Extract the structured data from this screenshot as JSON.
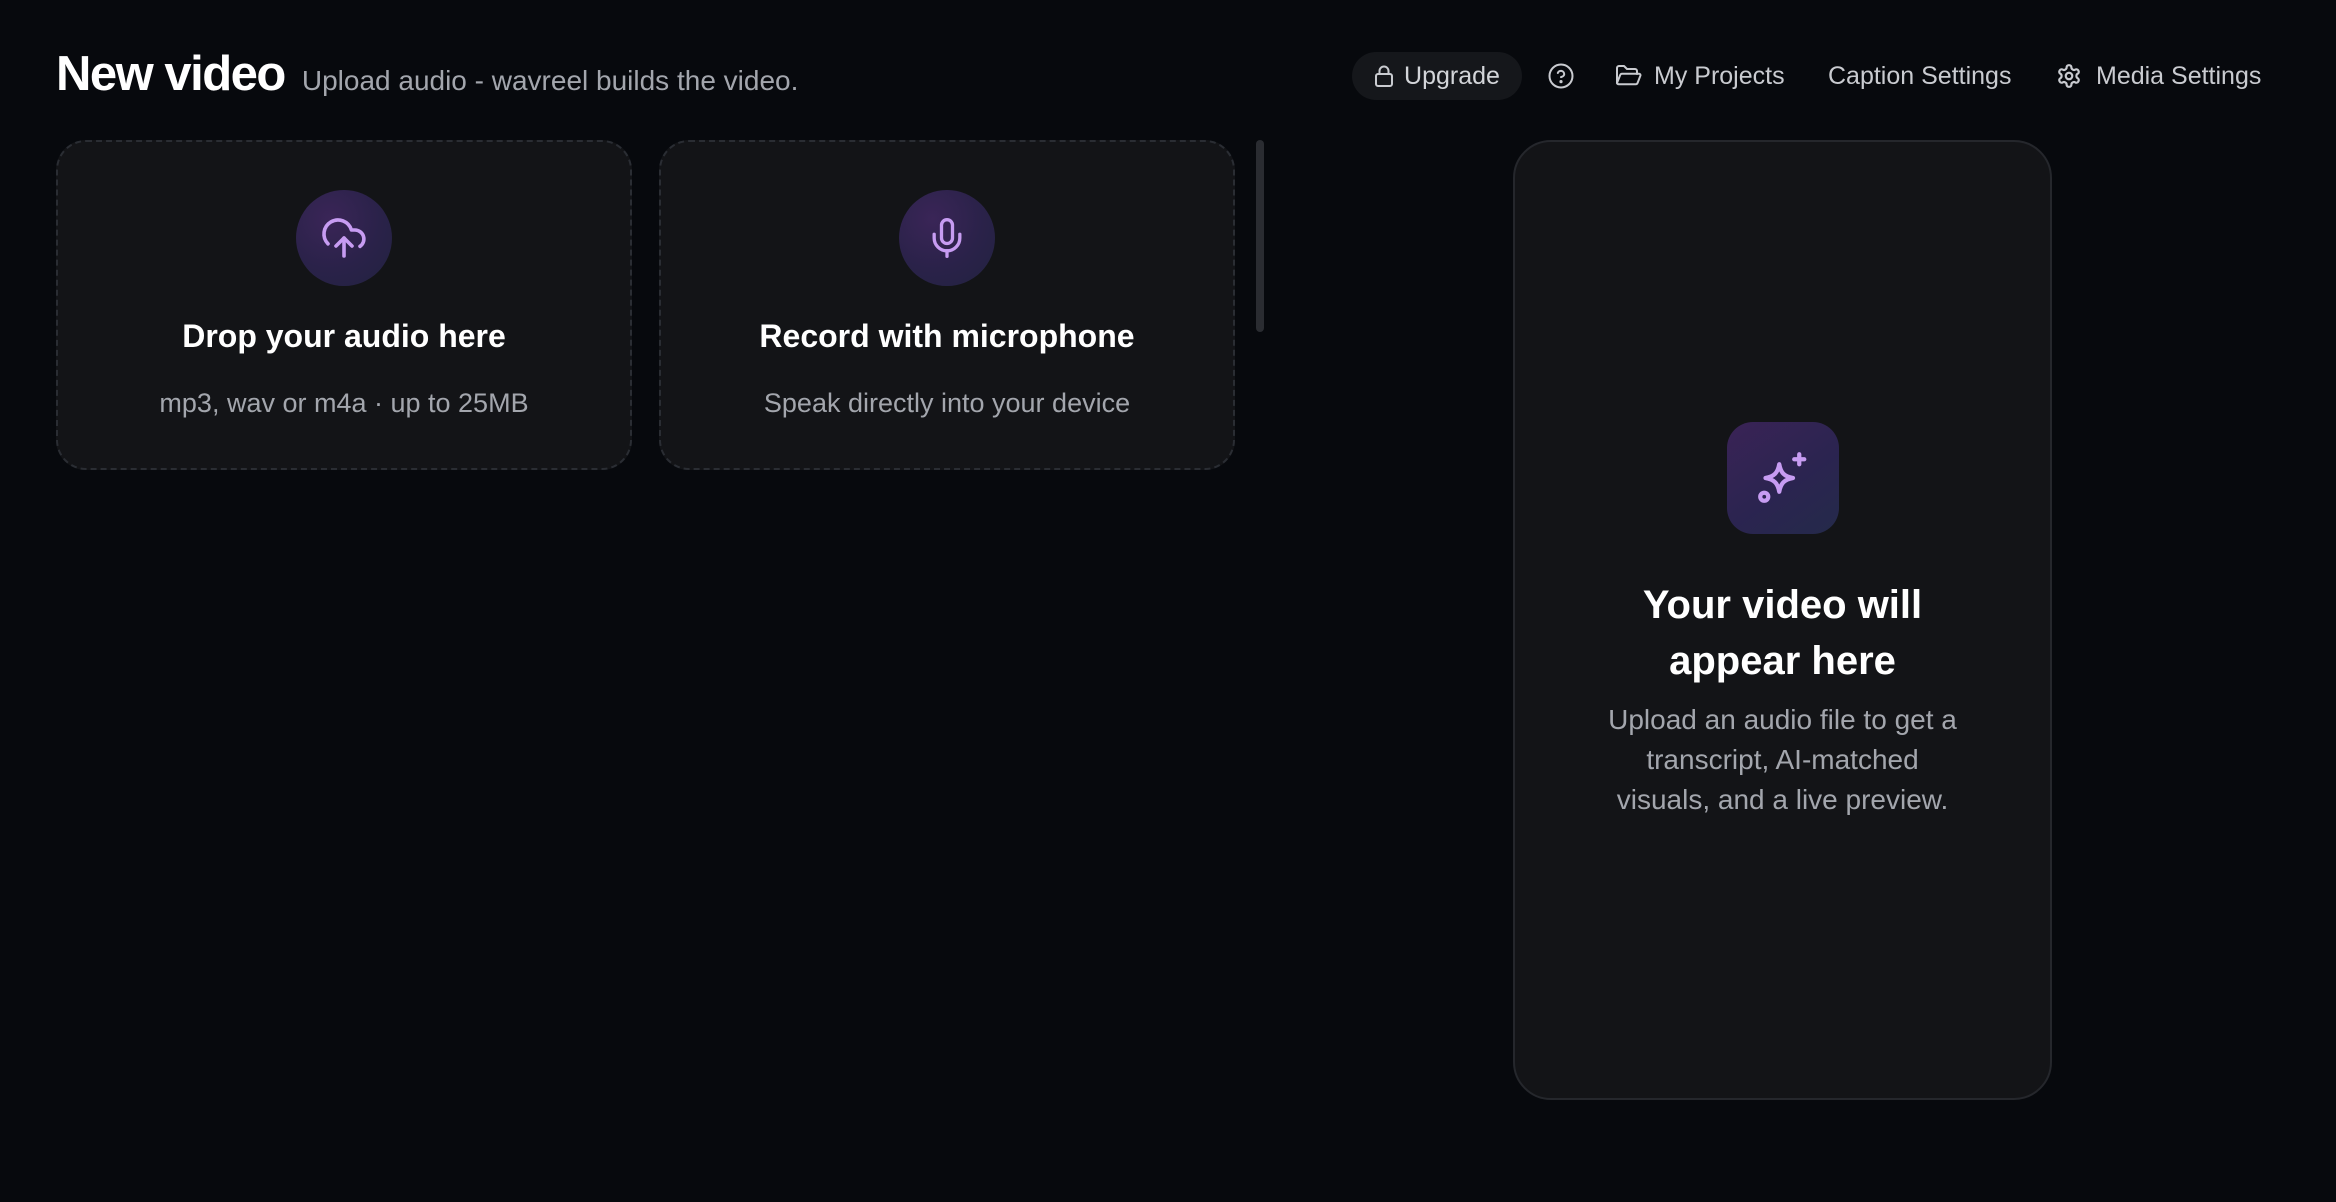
{
  "header": {
    "title": "New video",
    "subtitle": "Upload audio - wavreel builds the video."
  },
  "nav": {
    "upgrade_label": "Upgrade",
    "help_icon": "help-circle-icon",
    "projects_label": "My Projects",
    "captions_label": "Caption Settings",
    "media_label": "Media Settings"
  },
  "upload": {
    "drop": {
      "icon": "cloud-upload-icon",
      "title": "Drop your audio here",
      "subtitle": "mp3, wav or m4a · up to 25MB"
    },
    "record": {
      "icon": "microphone-icon",
      "title": "Record with microphone",
      "subtitle": "Speak directly into your device"
    }
  },
  "preview": {
    "icon": "sparkles-icon",
    "title": "Your video will appear here",
    "subtitle": "Upload an audio file to get a transcript, AI-matched visuals, and a live preview."
  },
  "colors": {
    "background": "#07090d",
    "card": "#131417",
    "accent": "#c79cf2",
    "muted_text": "#a3a6ad"
  }
}
